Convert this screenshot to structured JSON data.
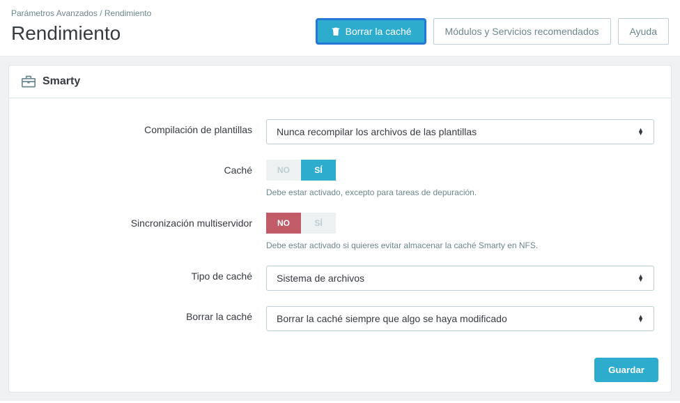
{
  "breadcrumb": {
    "parent": "Parámetros Avanzados",
    "sep": "/",
    "current": "Rendimiento"
  },
  "title": "Rendimiento",
  "actions": {
    "clear_cache": "Borrar la caché",
    "recommended": "Módulos y Servicios recomendados",
    "help": "Ayuda"
  },
  "panel": {
    "title": "Smarty",
    "fields": {
      "template_compilation": {
        "label": "Compilación de plantillas",
        "value": "Nunca recompilar los archivos de las plantillas"
      },
      "cache": {
        "label": "Caché",
        "no": "NO",
        "yes": "SÍ",
        "help": "Debe estar activado, excepto para tareas de depuración."
      },
      "multi_sync": {
        "label": "Sincronización multiservidor",
        "no": "NO",
        "yes": "SÍ",
        "help": "Debe estar activado si quieres evitar almacenar la caché Smarty en NFS."
      },
      "cache_type": {
        "label": "Tipo de caché",
        "value": "Sistema de archivos"
      },
      "clear_cache": {
        "label": "Borrar la caché",
        "value": "Borrar la caché siempre que algo se haya modificado"
      }
    },
    "save": "Guardar"
  }
}
